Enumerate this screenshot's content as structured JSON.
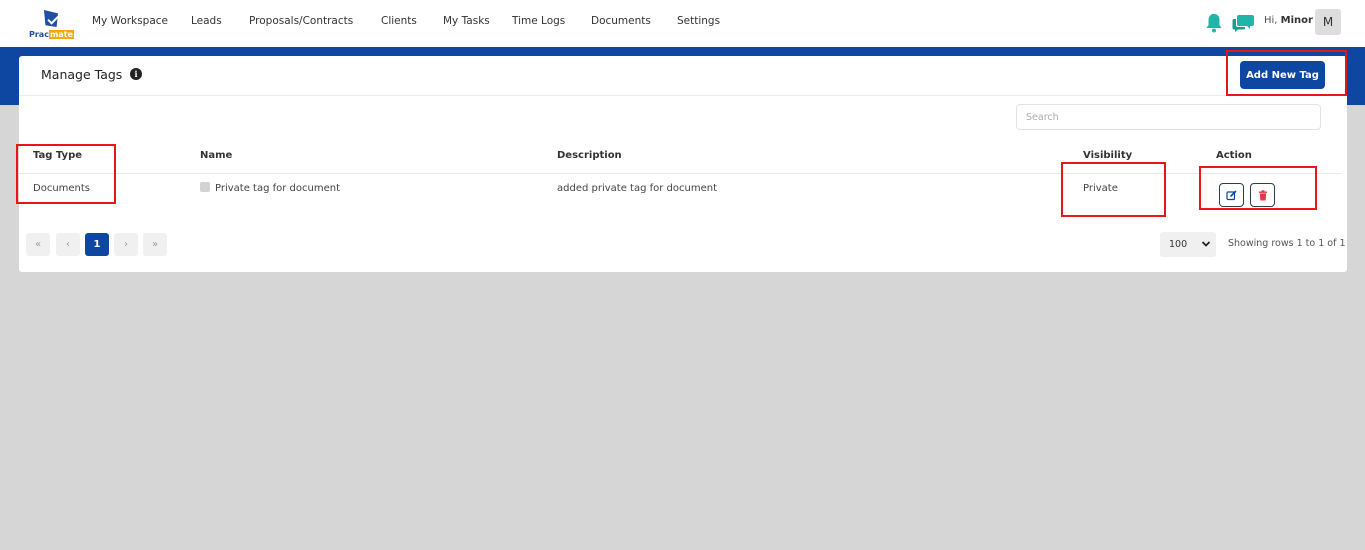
{
  "brand": {
    "part1": "Prac",
    "part2": "mate"
  },
  "nav": [
    "My Workspace",
    "Leads",
    "Proposals/Contracts",
    "Clients",
    "My Tasks",
    "Time Logs",
    "Documents",
    "Settings"
  ],
  "user": {
    "greeting": "Hi,",
    "name": "Minor",
    "initial": "M"
  },
  "page": {
    "title": "Manage Tags",
    "add_button": "Add New Tag"
  },
  "search": {
    "placeholder": "Search",
    "value": ""
  },
  "table": {
    "headers": [
      "Tag Type",
      "Name",
      "Description",
      "Visibility",
      "Action"
    ],
    "rows": [
      {
        "tag_type": "Documents",
        "name": "Private tag for document",
        "description": "added private tag for document",
        "visibility": "Private"
      }
    ]
  },
  "pagination": {
    "first": "«",
    "prev": "‹",
    "current": "1",
    "next": "›",
    "last": "»",
    "per_page": "100",
    "summary": "Showing rows 1 to  1 of 1"
  },
  "colors": {
    "primary": "#0d47a1",
    "accent_teal": "#1fb5a8",
    "annotation_red": "#e8151b",
    "delete_red": "#e8374a"
  },
  "icons": [
    "bell-icon",
    "chat-icon",
    "info-icon",
    "edit-icon",
    "trash-icon",
    "chevron-down-icon"
  ]
}
